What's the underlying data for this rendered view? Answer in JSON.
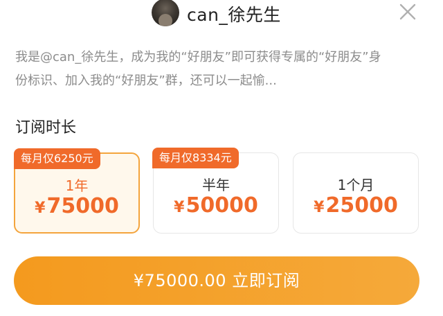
{
  "header": {
    "username": "can_徐先生"
  },
  "description": {
    "line1": "我是@can_徐先生，成为我的“好朋友”即可获得专属的“好朋友”身",
    "line2": "份标识、加入我的“好朋友”群，还可以一起愉..."
  },
  "subscription": {
    "title": "订阅时长",
    "plans": [
      {
        "badge": "每月仅6250元",
        "period": "1年",
        "currency": "¥",
        "price": "75000",
        "selected": true
      },
      {
        "badge": "每月仅8334元",
        "period": "半年",
        "currency": "¥",
        "price": "50000",
        "selected": false
      },
      {
        "badge": "",
        "period": "1个月",
        "currency": "¥",
        "price": "25000",
        "selected": false
      }
    ]
  },
  "action": {
    "subscribe_label": "¥75000.00 立即订阅"
  },
  "colors": {
    "accent": "#f06a2a",
    "button": "#f49a1e",
    "selected_border": "#f4a43c",
    "muted_text": "#8c8c8c"
  },
  "icons": {
    "close": "close-icon",
    "avatar": "avatar"
  }
}
